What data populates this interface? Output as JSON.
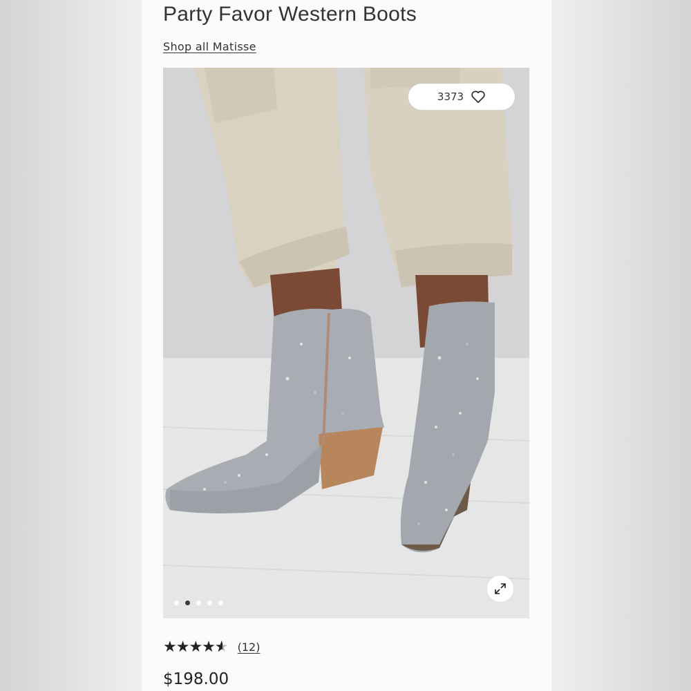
{
  "product": {
    "title": "Party Favor Western Boots",
    "shop_link": "Shop all Matisse",
    "likes": "3373",
    "rating": 4.5,
    "review_count": "(12)",
    "price": "$198.00"
  },
  "gallery": {
    "image_count": 5,
    "active_index": 1
  },
  "icons": {
    "like": "heart-icon",
    "expand": "expand-icon"
  },
  "colors": {
    "background": "#fdfbfa",
    "text": "#222222",
    "active_dot": "#333333"
  }
}
